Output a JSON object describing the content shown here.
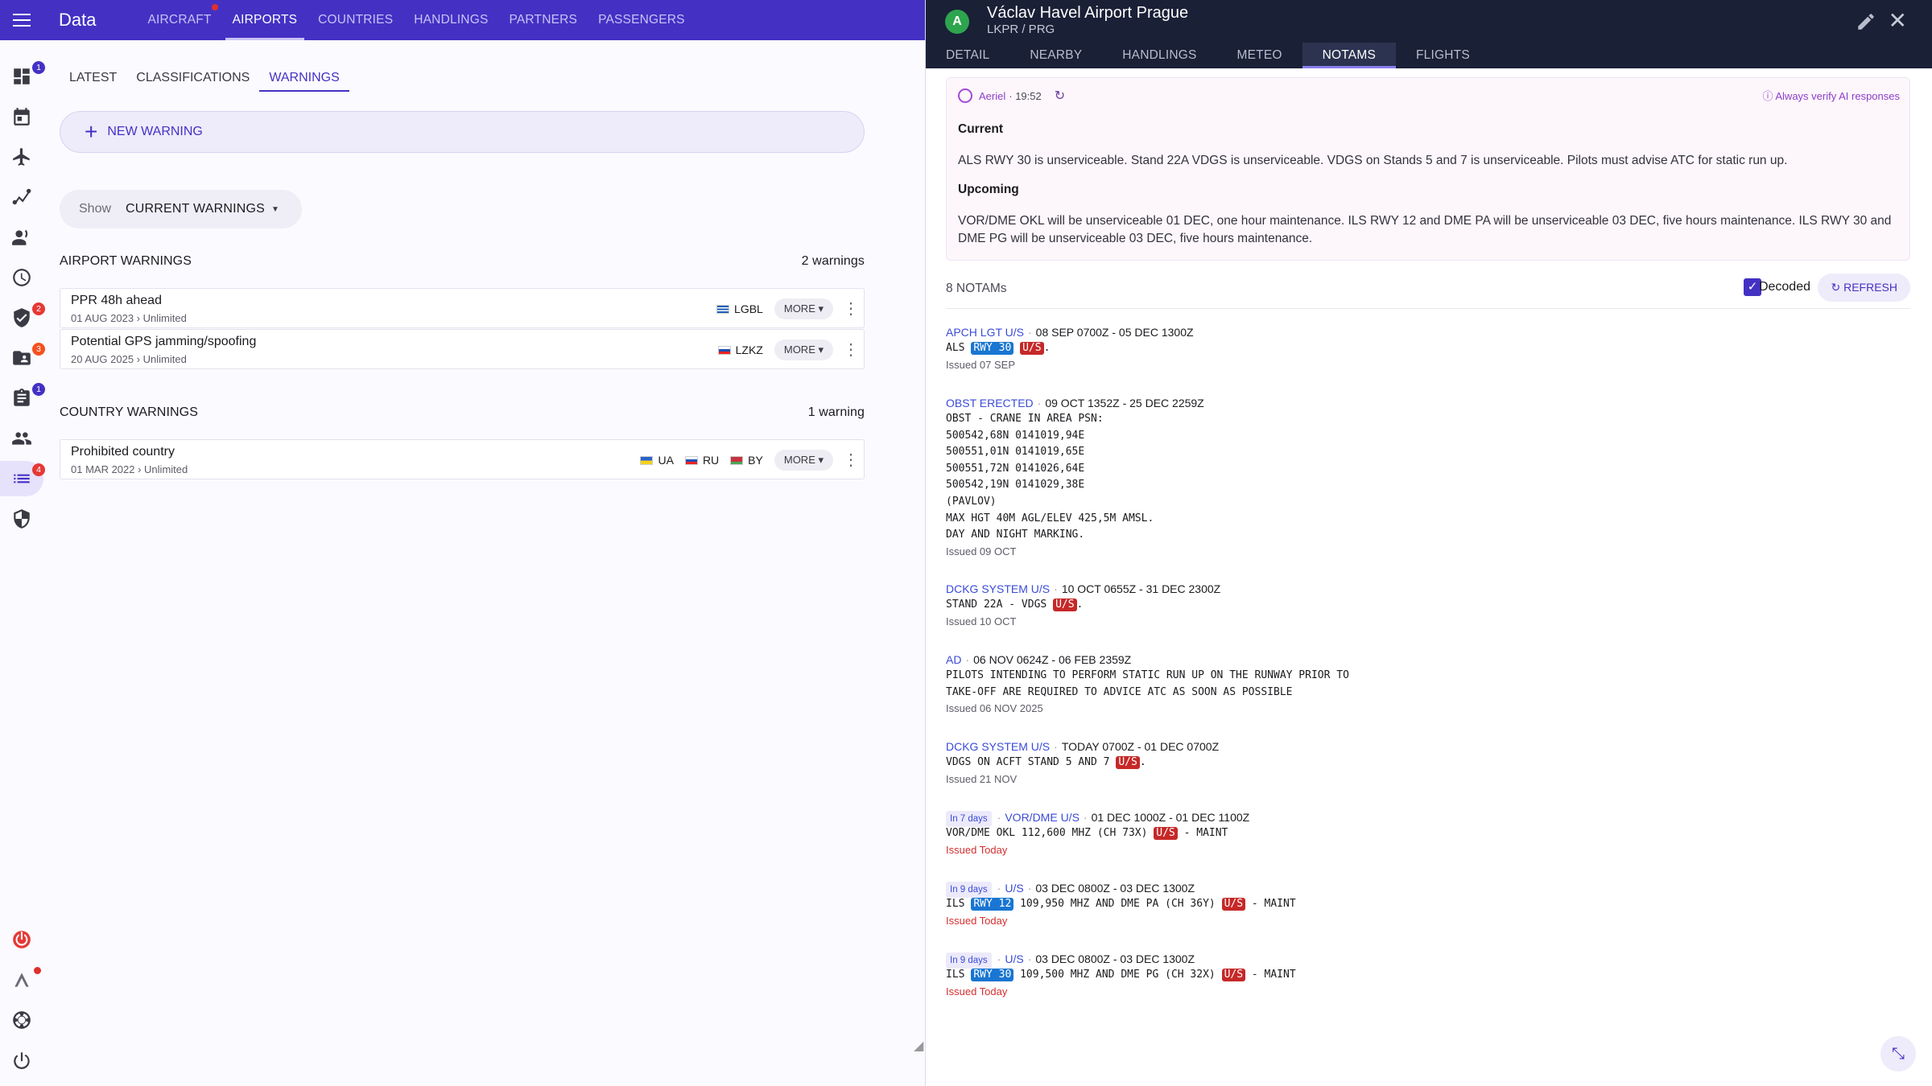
{
  "app": {
    "title": "Data"
  },
  "top_tabs": [
    {
      "label": "AIRCRAFT",
      "dot": true
    },
    {
      "label": "AIRPORTS",
      "active": true
    },
    {
      "label": "COUNTRIES"
    },
    {
      "label": "HANDLINGS"
    },
    {
      "label": "PARTNERS"
    },
    {
      "label": "PASSENGERS"
    }
  ],
  "rail": {
    "badges": {
      "dashboard": "1",
      "security": "2",
      "contacts": "3",
      "tasks": "1",
      "lists": "4"
    }
  },
  "sub_tabs": [
    "LATEST",
    "CLASSIFICATIONS",
    "WARNINGS"
  ],
  "new_warning": {
    "label": "NEW WARNING"
  },
  "filter": {
    "show_label": "Show",
    "value": "CURRENT WARNINGS"
  },
  "airport_warnings": {
    "title": "AIRPORT WARNINGS",
    "count": "2 warnings",
    "items": [
      {
        "title": "PPR 48h ahead",
        "sub": "01 AUG 2023 › Unlimited",
        "codes": [
          "LGBL"
        ]
      },
      {
        "title": "Potential GPS jamming/spoofing",
        "sub": "20 AUG 2025 › Unlimited",
        "codes": [
          "LZKZ"
        ]
      }
    ]
  },
  "country_warnings": {
    "title": "COUNTRY WARNINGS",
    "count": "1 warning",
    "items": [
      {
        "title": "Prohibited country",
        "sub": "01 MAR 2022 › Unlimited",
        "codes": [
          "UA",
          "RU",
          "BY"
        ]
      }
    ]
  },
  "more_label": "MORE",
  "panel": {
    "avatar": "A",
    "title": "Václav Havel Airport Prague",
    "subtitle": "LKPR / PRG",
    "tabs": [
      "DETAIL",
      "NEARBY",
      "HANDLINGS",
      "METEO",
      "NOTAMS",
      "FLIGHTS"
    ],
    "active_tab": "NOTAMS"
  },
  "ai": {
    "name": "Aeriel",
    "time": "· 19:52",
    "verify": "Always verify AI responses",
    "current_title": "Current",
    "current_text": "ALS RWY 30 is unserviceable. Stand 22A VDGS is unserviceable. VDGS on Stands 5 and 7 is unserviceable. Pilots must advise ATC for static run up.",
    "upcoming_title": "Upcoming",
    "upcoming_text": "VOR/DME OKL will be unserviceable 01 DEC, one hour maintenance. ILS RWY 12 and DME PA will be unserviceable 03 DEC, five hours maintenance. ILS RWY 30 and DME PG will be unserviceable 03 DEC, five hours maintenance."
  },
  "notams_bar": {
    "count": "8 NOTAMs",
    "decoded": "Decoded",
    "refresh": "REFRESH"
  },
  "notams": [
    {
      "type": "APCH LGT U/S",
      "period": "08 SEP 0700Z - 05 DEC 1300Z",
      "issued": "Issued 07 SEP"
    },
    {
      "type": "OBST ERECTED",
      "period": "09 OCT 1352Z - 25 DEC 2259Z",
      "issued": "Issued 09 OCT",
      "lines": [
        "OBST - CRANE IN AREA PSN:",
        "500542,68N 0141019,94E",
        "500551,01N 0141019,65E",
        "500551,72N 0141026,64E",
        "500542,19N 0141029,38E",
        "(PAVLOV)",
        "MAX HGT 40M AGL/ELEV 425,5M AMSL.",
        "DAY AND NIGHT MARKING."
      ]
    },
    {
      "type": "DCKG SYSTEM U/S",
      "period": "10 OCT 0655Z - 31 DEC 2300Z",
      "issued": "Issued 10 OCT"
    },
    {
      "type": "AD",
      "period": "06 NOV 0624Z - 06 FEB 2359Z",
      "issued": "Issued 06 NOV 2025",
      "lines": [
        "PILOTS INTENDING TO PERFORM STATIC RUN UP ON THE RUNWAY PRIOR TO",
        "TAKE-OFF ARE REQUIRED TO ADVICE ATC AS SOON AS POSSIBLE"
      ]
    },
    {
      "type": "DCKG SYSTEM U/S",
      "period": "TODAY 0700Z - 01 DEC 0700Z",
      "issued": "Issued 21 NOV"
    },
    {
      "days": "In 7 days",
      "type": "VOR/DME U/S",
      "period": "01 DEC 1000Z - 01 DEC 1100Z",
      "issued": "Issued Today"
    },
    {
      "days": "In 9 days",
      "type": "U/S",
      "period": "03 DEC 0800Z - 03 DEC 1300Z",
      "issued": "Issued Today"
    },
    {
      "days": "In 9 days",
      "type": "U/S",
      "period": "03 DEC 0800Z - 03 DEC 1300Z",
      "issued": "Issued Today"
    }
  ],
  "notam_tokens": {
    "als": "ALS",
    "rwy30": "RWY 30",
    "rwy12": "RWY 12",
    "us": "U/S",
    "dot": ".",
    "stand22a": "STAND 22A - VDGS",
    "vdgs57": "VDGS ON ACFT STAND 5 AND 7",
    "vor": "VOR/DME OKL 112,600 MHZ (CH 73X)",
    "maint": " - MAINT",
    "ils": "ILS",
    "ils12": " 109,950 MHZ AND DME PA (CH 36Y) ",
    "ils30": " 109,500 MHZ AND DME PG (CH 32X) "
  }
}
